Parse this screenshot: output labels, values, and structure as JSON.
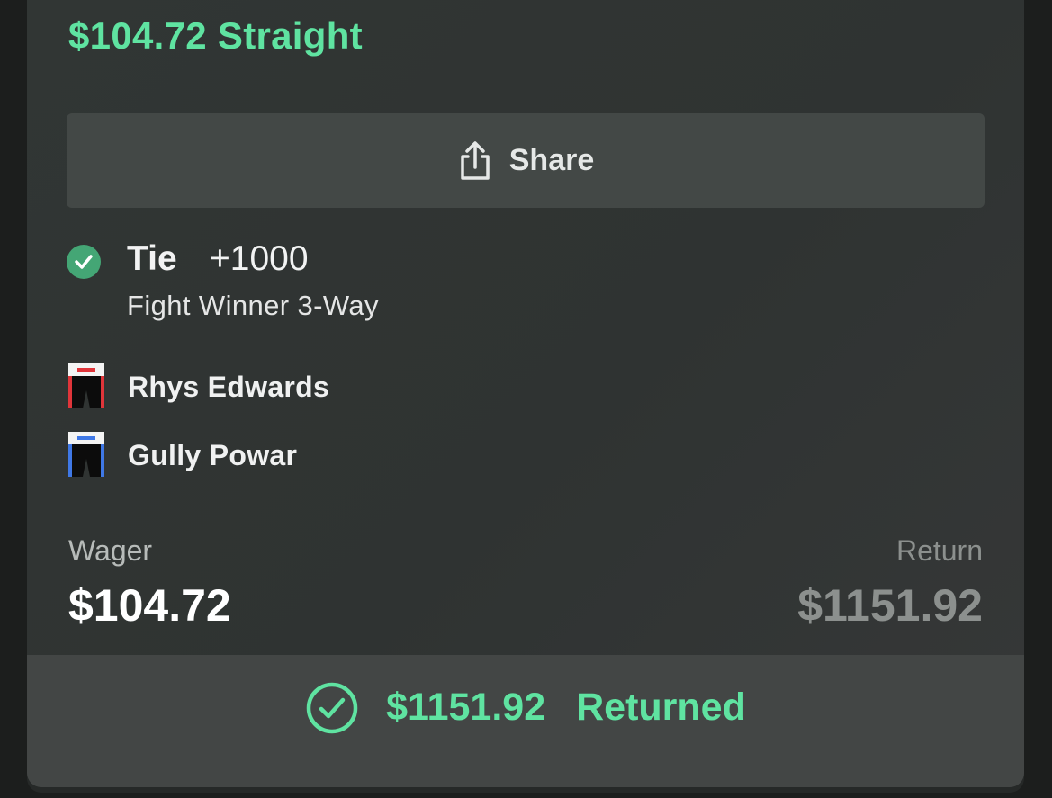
{
  "bet": {
    "title": "$104.72 Straight"
  },
  "share": {
    "label": "Share"
  },
  "selection": {
    "name": "Tie",
    "odds": "+1000",
    "market": "Fight Winner 3-Way",
    "status_icon": "check-circle-filled-icon"
  },
  "fighters": [
    {
      "name": "Rhys Edwards",
      "icon": "boxing-trunks-red-icon",
      "color": "#e0353a"
    },
    {
      "name": "Gully Powar",
      "icon": "boxing-trunks-blue-icon",
      "color": "#3f78e6"
    }
  ],
  "wager": {
    "label": "Wager",
    "value": "$104.72"
  },
  "return": {
    "label": "Return",
    "value": "$1151.92"
  },
  "result": {
    "amount": "$1151.92",
    "text": "Returned",
    "icon": "check-circle-outline-icon"
  },
  "colors": {
    "accent": "#5fe3a1",
    "success_badge": "#44a675"
  }
}
